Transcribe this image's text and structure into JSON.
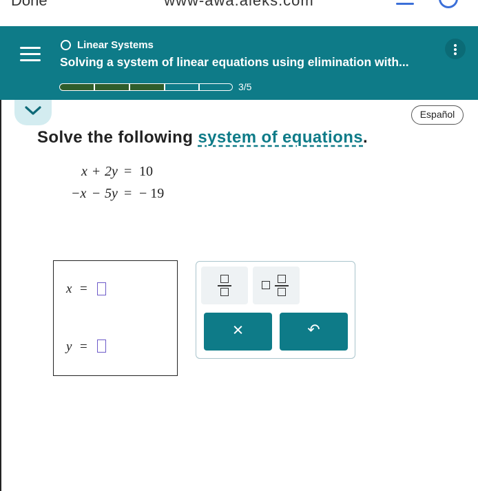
{
  "browser": {
    "left_label": "Done",
    "url": "www-awa.aleks.com"
  },
  "header": {
    "topic": "Linear Systems",
    "title": "Solving a system of linear equations using elimination with...",
    "progress": {
      "total_segments": 5,
      "completed_segments": 3,
      "label": "3/5"
    },
    "colors": {
      "header_bg": "#0e7b88",
      "progress_fill": "#2f5d2b"
    }
  },
  "language_button": "Español",
  "question": {
    "prefix": "Solve the following ",
    "link": "system of equations",
    "suffix": "."
  },
  "equations": [
    {
      "lhs_a": "x",
      "op": "+",
      "lhs_b": "2y",
      "eq": "=",
      "rhs": "10"
    },
    {
      "lhs_a": "−x",
      "op": "−",
      "lhs_b": "5y",
      "eq": "=",
      "rhs": "− 19"
    }
  ],
  "answers": [
    {
      "variable": "x",
      "eq": "=",
      "value": ""
    },
    {
      "variable": "y",
      "eq": "=",
      "value": ""
    }
  ],
  "keypad": {
    "clear_glyph": "×",
    "undo_glyph": "↶",
    "keys": [
      "fraction-key",
      "mixed-number-key",
      "clear-key",
      "undo-key"
    ]
  }
}
